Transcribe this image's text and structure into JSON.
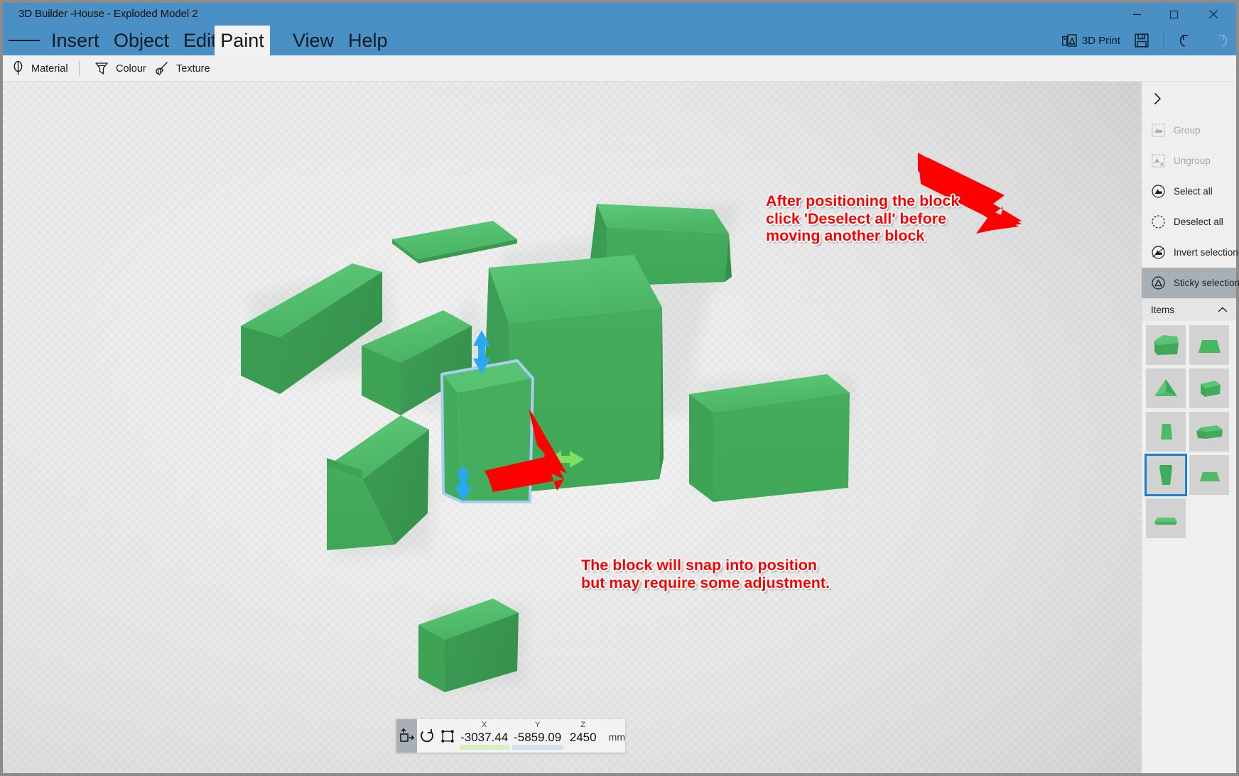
{
  "window": {
    "title": "3D Builder -House - Exploded Model 2",
    "accent_color": "#4a90c4",
    "controls": {
      "minimize": "minimize-button",
      "maximize": "maximize-button",
      "close": "close-button"
    }
  },
  "menubar": {
    "hamburger": "hamburger-menu",
    "items": [
      {
        "label": "Insert",
        "active": false
      },
      {
        "label": "Object",
        "active": false
      },
      {
        "label": "Edit",
        "active": false
      },
      {
        "label": "Paint",
        "active": true
      },
      {
        "label": "View",
        "active": false
      },
      {
        "label": "Help",
        "active": false
      }
    ],
    "right": {
      "print_label": "3D Print",
      "save_label": "Save",
      "undo_label": "Undo",
      "redo_label": "Redo"
    }
  },
  "subtoolbar": {
    "items": [
      {
        "label": "Material",
        "icon": "material-icon"
      },
      {
        "label": "Colour",
        "icon": "colour-icon"
      },
      {
        "label": "Texture",
        "icon": "texture-icon"
      }
    ]
  },
  "right_panel": {
    "collapse_label": "Expand panel",
    "actions": [
      {
        "label": "Group",
        "state": "disabled"
      },
      {
        "label": "Ungroup",
        "state": "disabled"
      },
      {
        "label": "Select all",
        "state": "normal"
      },
      {
        "label": "Deselect all",
        "state": "normal"
      },
      {
        "label": "Invert selection",
        "state": "normal"
      },
      {
        "label": "Sticky selection",
        "state": "selected"
      }
    ],
    "items_section": {
      "title": "Items",
      "collapsed": false,
      "thumbnails": [
        {
          "shape": "cube",
          "selected": false
        },
        {
          "shape": "trapezoid-flat",
          "selected": false
        },
        {
          "shape": "pyramid",
          "selected": false
        },
        {
          "shape": "box-small",
          "selected": false
        },
        {
          "shape": "tall-slab",
          "selected": false
        },
        {
          "shape": "wide-box",
          "selected": false
        },
        {
          "shape": "tall-tapered",
          "selected": true
        },
        {
          "shape": "flat-box",
          "selected": false
        },
        {
          "shape": "wedge",
          "selected": false
        }
      ]
    }
  },
  "annotations": [
    {
      "id": "anno1",
      "text": "After positioning the block\nclick 'Deselect all' before\nmoving another block",
      "color": "#ff0000"
    },
    {
      "id": "anno2",
      "text": "The block will snap into position\nbut may require some adjustment.",
      "color": "#ff0000"
    }
  ],
  "bottom_toolbar": {
    "move_tool": {
      "name": "move-tool",
      "active": true
    },
    "rotate_tool": {
      "name": "rotate-tool",
      "active": false
    },
    "scale_tool": {
      "name": "scale-tool",
      "active": false
    },
    "coordinates": [
      {
        "axis": "X",
        "value": "-3037.44",
        "bar_color": "#d8f0c0"
      },
      {
        "axis": "Y",
        "value": "-5859.09",
        "bar_color": "#cde3ef"
      },
      {
        "axis": "Z",
        "value": "2450",
        "bar_color": "#f3f3f3"
      }
    ],
    "unit": "mm"
  },
  "scene": {
    "selection_color": "#a9cdf0",
    "block_fill": "#4cb866",
    "arrows": [
      {
        "name": "move-up-arrow",
        "color": "#2ba8f5"
      },
      {
        "name": "move-down-arrow",
        "color": "#2ba8f5"
      },
      {
        "name": "move-horizontal-arrow",
        "color": "#7ee060"
      }
    ]
  }
}
